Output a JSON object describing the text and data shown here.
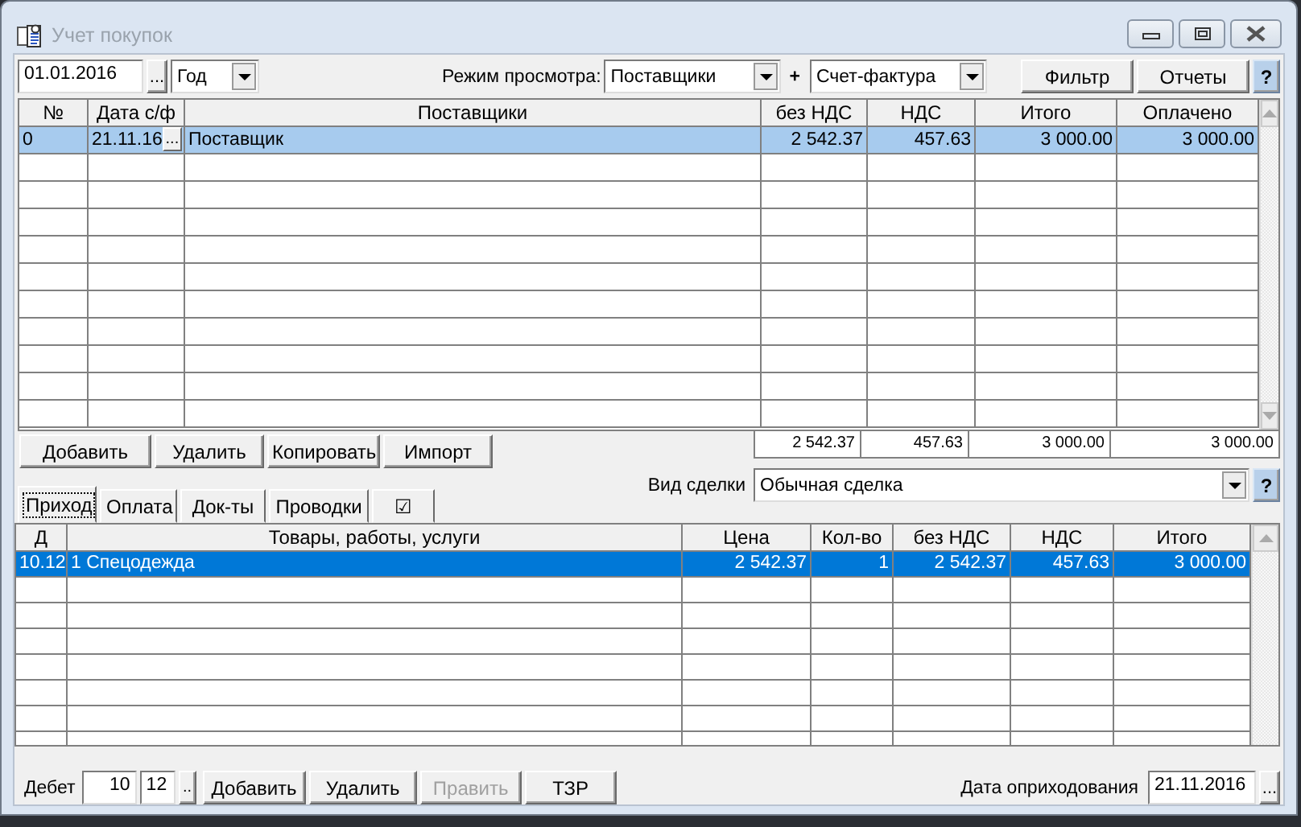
{
  "window": {
    "title": "Учет покупок"
  },
  "toolbar": {
    "date": "01.01.2016",
    "date_picker": "...",
    "period": "Год",
    "view_mode_label": "Режим просмотра:",
    "view_mode": "Поставщики",
    "plus": "+",
    "doc_type": "Счет-фактура",
    "buttons": [
      "Фильтр",
      "Отчеты"
    ],
    "help": "?"
  },
  "suppliers_table": {
    "columns": [
      "№",
      "Дата с/ф",
      "Поставщики",
      "без НДС",
      "НДС",
      "Итого",
      "Оплачено"
    ],
    "rows": [
      {
        "number": "0",
        "date": "21.11.16",
        "picker": "...",
        "supplier": "Поставщик",
        "net": "2 542.37",
        "vat": "457.63",
        "total": "3 000.00",
        "paid": "3 000.00",
        "selected": true
      }
    ],
    "totals": [
      "2 542.37",
      "457.63",
      "3 000.00",
      "3 000.00"
    ]
  },
  "actions": [
    "Добавить",
    "Удалить",
    "Копировать",
    "Импорт"
  ],
  "deal_type": {
    "label": "Вид сделки",
    "value": "Обычная сделка",
    "help": "?"
  },
  "tabs": [
    {
      "label": "Приход",
      "selected": true
    },
    {
      "label": "Оплата",
      "selected": false
    },
    {
      "label": "Док-ты",
      "selected": false
    },
    {
      "label": "Проводки",
      "selected": false
    },
    {
      "label": "☑",
      "selected": false
    }
  ],
  "items_table": {
    "columns": [
      "Д",
      "Товары, работы, услуги",
      "Цена",
      "Кол-во",
      "без НДС",
      "НДС",
      "Итого"
    ],
    "rows": [
      {
        "cells": [
          "10.12",
          "1 Спецодежда",
          "2 542.37",
          "1",
          "2 542.37",
          "457.63",
          "3 000.00"
        ],
        "selected": true
      }
    ]
  },
  "bottom": {
    "debit_label": "Дебет",
    "account": "10",
    "subaccount": "12",
    "picker": "..",
    "buttons": [
      {
        "label": "Добавить",
        "disabled": false
      },
      {
        "label": "Удалить",
        "disabled": false
      },
      {
        "label": "Править",
        "disabled": true
      },
      {
        "label": "ТЗР",
        "disabled": false
      }
    ],
    "date_label": "Дата оприходования",
    "date": "21.11.2016",
    "date_picker": "..."
  }
}
